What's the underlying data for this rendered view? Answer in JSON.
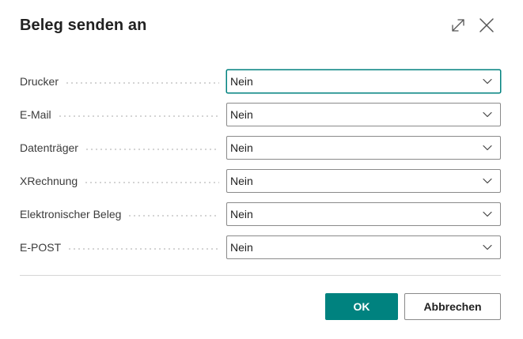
{
  "dialog": {
    "title": "Beleg senden an",
    "expand_icon": "expand-diagonal-icon",
    "close_icon": "close-icon"
  },
  "fields": [
    {
      "label": "Drucker",
      "value": "Nein"
    },
    {
      "label": "E-Mail",
      "value": "Nein"
    },
    {
      "label": "Datenträger",
      "value": "Nein"
    },
    {
      "label": "XRechnung",
      "value": "Nein"
    },
    {
      "label": "Elektronischer Beleg",
      "value": "Nein"
    },
    {
      "label": "E-POST",
      "value": "Nein"
    }
  ],
  "buttons": {
    "ok_label": "OK",
    "cancel_label": "Abbrechen"
  },
  "colors": {
    "accent": "#00827f",
    "border": "#8a8a8a",
    "divider": "#d6d6d6"
  }
}
